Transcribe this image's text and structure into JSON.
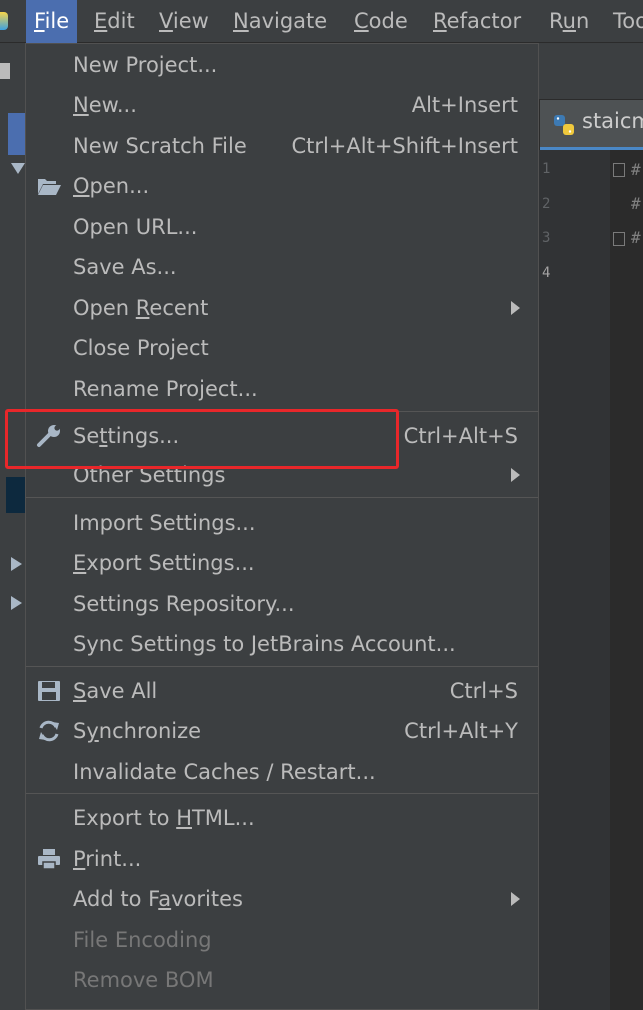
{
  "menubar": {
    "items": [
      {
        "pre": "",
        "mn": "F",
        "post": "ile"
      },
      {
        "pre": "",
        "mn": "E",
        "post": "dit"
      },
      {
        "pre": "",
        "mn": "V",
        "post": "iew"
      },
      {
        "pre": "",
        "mn": "N",
        "post": "avigate"
      },
      {
        "pre": "",
        "mn": "C",
        "post": "ode"
      },
      {
        "pre": "",
        "mn": "R",
        "post": "efactor"
      },
      {
        "pre": "R",
        "mn": "u",
        "post": "n"
      },
      {
        "pre": "",
        "mn": "",
        "post": "Too"
      }
    ]
  },
  "editor": {
    "tab_label": "staicm",
    "line_numbers": [
      "1",
      "2",
      "3",
      "4"
    ],
    "code_lines": [
      "#",
      "#",
      "#"
    ]
  },
  "file_menu": {
    "items": [
      {
        "pre": "New Project...",
        "mn": "",
        "post": "",
        "shortcut": ""
      },
      {
        "pre": "",
        "mn": "N",
        "post": "ew...",
        "shortcut": "Alt+Insert"
      },
      {
        "pre": "New Scratch File",
        "mn": "",
        "post": "",
        "shortcut": "Ctrl+Alt+Shift+Insert"
      },
      {
        "pre": "",
        "mn": "O",
        "post": "pen...",
        "shortcut": ""
      },
      {
        "pre": "Open URL...",
        "mn": "",
        "post": "",
        "shortcut": ""
      },
      {
        "pre": "Save As...",
        "mn": "",
        "post": "",
        "shortcut": ""
      },
      {
        "pre": "Open ",
        "mn": "R",
        "post": "ecent",
        "shortcut": ""
      },
      {
        "pre": "Close Project",
        "mn": "",
        "post": "",
        "shortcut": ""
      },
      {
        "pre": "Rename Project...",
        "mn": "",
        "post": "",
        "shortcut": ""
      },
      {
        "pre": "Se",
        "mn": "t",
        "post": "tings...",
        "shortcut": "Ctrl+Alt+S"
      },
      {
        "pre": "Other Settings",
        "mn": "",
        "post": "",
        "shortcut": ""
      },
      {
        "pre": "Import Settings...",
        "mn": "",
        "post": "",
        "shortcut": ""
      },
      {
        "pre": "",
        "mn": "E",
        "post": "xport Settings...",
        "shortcut": ""
      },
      {
        "pre": "Settings Repository...",
        "mn": "",
        "post": "",
        "shortcut": ""
      },
      {
        "pre": "Sync Settings to JetBrains Account...",
        "mn": "",
        "post": "",
        "shortcut": ""
      },
      {
        "pre": "",
        "mn": "S",
        "post": "ave All",
        "shortcut": "Ctrl+S"
      },
      {
        "pre": "S",
        "mn": "y",
        "post": "nchronize",
        "shortcut": "Ctrl+Alt+Y"
      },
      {
        "pre": "Invalidate Caches / Restart...",
        "mn": "",
        "post": "",
        "shortcut": ""
      },
      {
        "pre": "Export to ",
        "mn": "H",
        "post": "TML...",
        "shortcut": ""
      },
      {
        "pre": "",
        "mn": "P",
        "post": "rint...",
        "shortcut": ""
      },
      {
        "pre": "Add to F",
        "mn": "a",
        "post": "vorites",
        "shortcut": ""
      },
      {
        "pre": "File Encoding",
        "mn": "",
        "post": "",
        "shortcut": ""
      },
      {
        "pre": "Remove BOM",
        "mn": "",
        "post": "",
        "shortcut": ""
      }
    ]
  },
  "icons": {
    "open": "folder-open-icon",
    "settings": "wrench-icon",
    "save_all": "floppy-disk-icon",
    "synchronize": "refresh-icon",
    "print": "printer-icon",
    "submenu": "submenu-arrow-icon"
  },
  "colors": {
    "menubar_active": "#4b6eaf",
    "menu_bg": "#3c3f41",
    "highlight_box": "#e8272a",
    "disabled_text": "#777777"
  }
}
